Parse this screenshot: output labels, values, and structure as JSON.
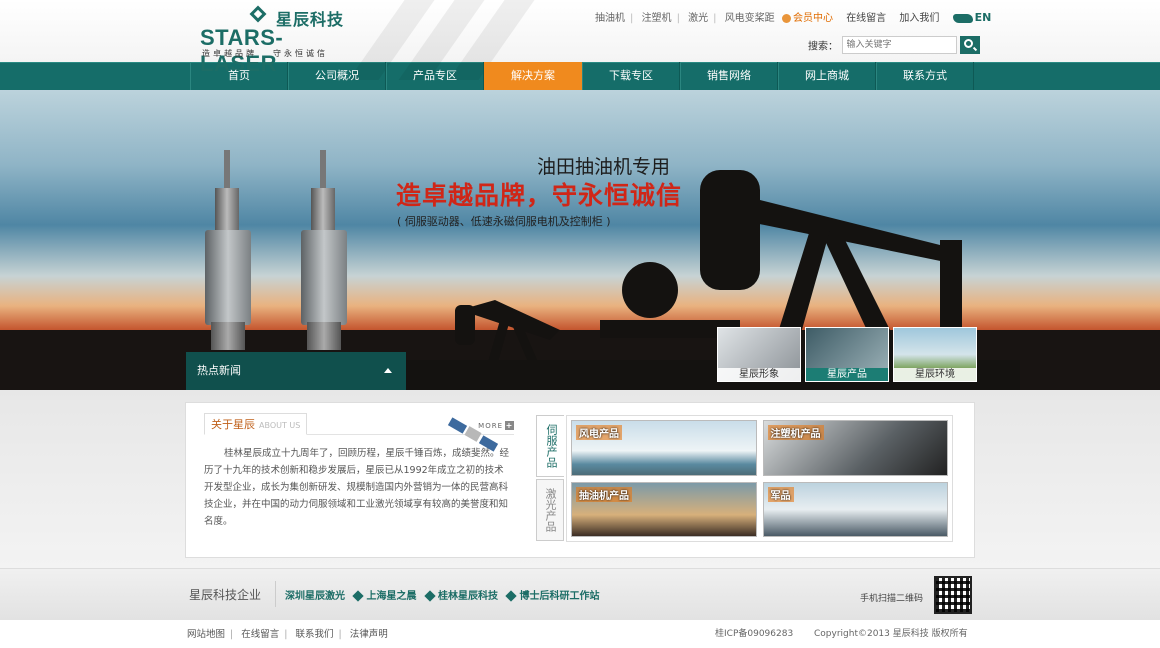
{
  "header": {
    "logo_cn": "星辰科技",
    "logo_en": "STARS-LASER",
    "slogan_left": "造卓越品牌",
    "slogan_right": "守永恒诚信",
    "top_links": [
      "抽油机",
      "注塑机",
      "激光",
      "风电变桨距"
    ],
    "member_center": "会员中心",
    "online_message": "在线留言",
    "join_us": "加入我们",
    "lang": "EN",
    "search_label": "搜索：",
    "search_placeholder": "输入关键字"
  },
  "nav": {
    "items": [
      "首页",
      "公司概况",
      "产品专区",
      "解决方案",
      "下载专区",
      "销售网络",
      "网上商城",
      "联系方式"
    ],
    "active": "解决方案"
  },
  "banner": {
    "title": "油田抽油机专用",
    "slogan": "造卓越品牌，守永恒诚信",
    "subtitle": "( 伺服驱动器、低速永磁伺服电机及控制柜 )",
    "hot_news": "热点新闻",
    "thumbs": [
      {
        "label": "星辰形象",
        "active": false
      },
      {
        "label": "星辰产品",
        "active": true
      },
      {
        "label": "星辰环境",
        "active": false
      }
    ]
  },
  "about": {
    "tab_title": "关于星辰",
    "tab_en": "ABOUT US",
    "more": "MORE",
    "text": "桂林星辰成立十九周年了，回顾历程，星辰千锤百炼，成绩斐然。经历了十九年的技术创新和稳步发展后，星辰已从1992年成立之初的技术开发型企业，成长为集创新研发、规模制造国内外营销为一体的民营高科技企业，并在中国的动力伺服领域和工业激光领域享有较高的美誉度和知名度。"
  },
  "products": {
    "tabs": [
      "伺服产品",
      "激光产品"
    ],
    "active_tab": "伺服产品",
    "items": [
      "风电产品",
      "注塑机产品",
      "抽油机产品",
      "军品"
    ]
  },
  "footer": {
    "brand": "星辰科技企业",
    "links": [
      "深圳星辰激光",
      "上海星之晨",
      "桂林星辰科技",
      "博士后科研工作站"
    ],
    "qr_text": "手机扫描二维码",
    "bottom_links": [
      "网站地图",
      "在线留言",
      "联系我们",
      "法律声明"
    ],
    "icp": "桂ICP备09096283",
    "copyright": "Copyright©2013  星辰科技  版权所有"
  }
}
